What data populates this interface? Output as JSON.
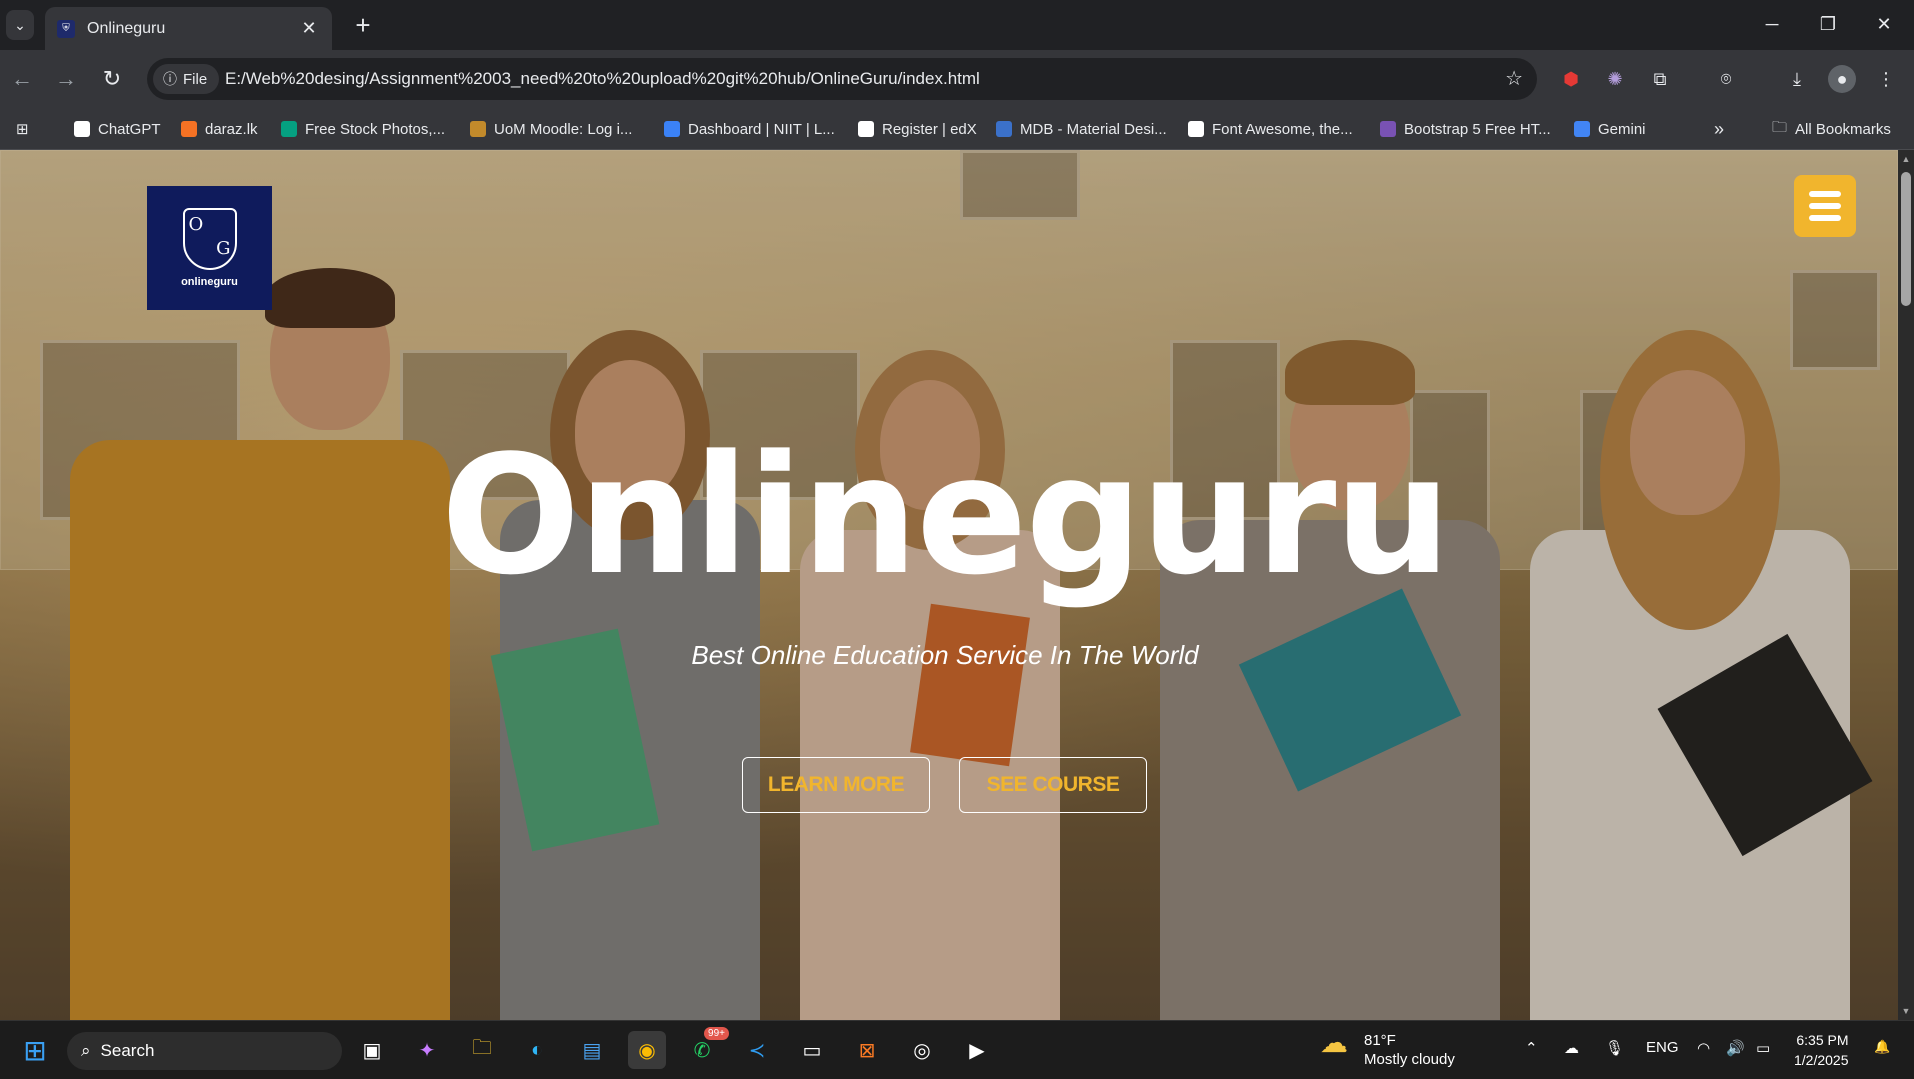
{
  "browser": {
    "tab_title": "Onlineguru",
    "url_chip": "File",
    "url": "E:/Web%20desing/Assignment%2003_need%20to%20upload%20git%20hub/OnlineGuru/index.html"
  },
  "bookmarks": [
    {
      "label": "ChatGPT",
      "color": "#ffffff"
    },
    {
      "label": "daraz.lk",
      "color": "#f57224"
    },
    {
      "label": "Free Stock Photos,...",
      "color": "#05a081"
    },
    {
      "label": "UoM Moodle: Log i...",
      "color": "#c28a2b"
    },
    {
      "label": "Dashboard | NIIT | L...",
      "color": "#3b82f6"
    },
    {
      "label": "Register | edX",
      "color": "#ffffff"
    },
    {
      "label": "MDB - Material Desi...",
      "color": "#3b71ca"
    },
    {
      "label": "Font Awesome, the...",
      "color": "#ffffff"
    },
    {
      "label": "Bootstrap 5 Free HT...",
      "color": "#7952b3"
    },
    {
      "label": "Gemini",
      "color": "#4285f4"
    }
  ],
  "all_bookmarks": "All Bookmarks",
  "page": {
    "logo_text": "onlineguru",
    "logo_letters": {
      "o": "O",
      "g": "G"
    },
    "title": "Onlineguru",
    "subtitle": "Best Online Education Service In The World",
    "btn_learn": "LEARN MORE",
    "btn_course": "SEE COURSE",
    "accent": "#f1b52d"
  },
  "taskbar": {
    "search": "Search",
    "whatsapp_badge": "99+",
    "temp": "81°F",
    "weather": "Mostly cloudy",
    "lang": "ENG",
    "time": "6:35 PM",
    "date": "1/2/2025"
  }
}
